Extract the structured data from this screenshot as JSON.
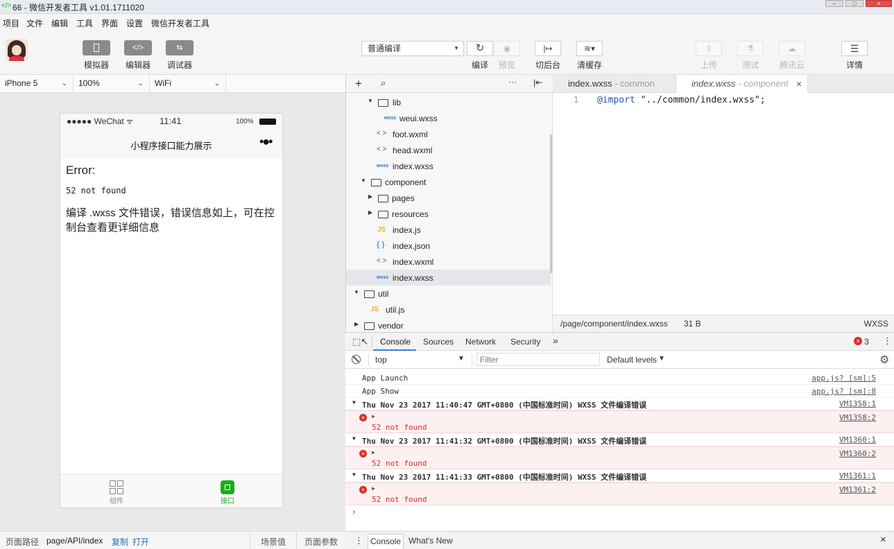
{
  "window": {
    "title": "66 - 微信开发者工具 v1.01.1711020"
  },
  "menu": [
    "项目",
    "文件",
    "编辑",
    "工具",
    "界面",
    "设置",
    "微信开发者工具"
  ],
  "toolbar": {
    "simulator": "模拟器",
    "editor": "编辑器",
    "debugger": "调试器",
    "compile_mode": "普通编译",
    "compile": "编译",
    "preview": "预览",
    "background": "切后台",
    "clear_cache": "清缓存",
    "upload": "上传",
    "test": "测试",
    "tencent_cloud": "腾讯云",
    "details": "详情"
  },
  "device": {
    "model": "iPhone 5",
    "zoom": "100%",
    "network": "WiFi"
  },
  "phone": {
    "carrier": "●●●●● WeChat",
    "time": "11:41",
    "battery": "100%",
    "nav_title": "小程序接口能力展示",
    "error_title": "Error:",
    "error_code": "52 not found",
    "error_msg": "编译 .wxss 文件错误，错误信息如上，可在控制台查看更详细信息",
    "tab_component": "组件",
    "tab_api": "接口"
  },
  "left_status": {
    "path_label": "页面路径",
    "path": "page/API/index",
    "copy": "复制",
    "open": "打开",
    "scene": "场景值",
    "params": "页面参数"
  },
  "tree": [
    {
      "name": "lib",
      "type": "folder",
      "open": true
    },
    {
      "name": "weui.wxss",
      "type": "wxss"
    },
    {
      "name": "foot.wxml",
      "type": "wxml"
    },
    {
      "name": "head.wxml",
      "type": "wxml"
    },
    {
      "name": "index.wxss",
      "type": "wxss"
    },
    {
      "name": "component",
      "type": "folder",
      "open": true
    },
    {
      "name": "pages",
      "type": "folder",
      "open": false
    },
    {
      "name": "resources",
      "type": "folder",
      "open": false
    },
    {
      "name": "index.js",
      "type": "js"
    },
    {
      "name": "index.json",
      "type": "json"
    },
    {
      "name": "index.wxml",
      "type": "wxml"
    },
    {
      "name": "index.wxss",
      "type": "wxss",
      "selected": true
    },
    {
      "name": "util",
      "type": "folder",
      "open": true
    },
    {
      "name": "util.js",
      "type": "js"
    },
    {
      "name": "vendor",
      "type": "folder",
      "open": false
    }
  ],
  "icons": {
    "js": "JS",
    "wxml": "< >",
    "json": "{ }",
    "wxss": "wxss"
  },
  "editor": {
    "tab1_name": "index.wxss",
    "tab1_dir": " - common",
    "tab2_name": "index.wxss",
    "tab2_dir": " - component",
    "line_no": "1",
    "code_kw": "@import",
    "code_str": " \"../common/index.wxss\";",
    "file_path": "/page/component/index.wxss",
    "file_size": "31 B",
    "lang": "WXSS"
  },
  "devtools": {
    "tabs": [
      "Console",
      "Sources",
      "Network",
      "Security"
    ],
    "more": "»",
    "error_count": "3",
    "context": "top",
    "filter_placeholder": "Filter",
    "levels": "Default levels",
    "logs": [
      {
        "kind": "info",
        "text": "App Launch",
        "src": "app.js? [sm]:5"
      },
      {
        "kind": "info",
        "text": "App Show",
        "src": "app.js? [sm]:8"
      },
      {
        "kind": "group",
        "text": "Thu Nov 23 2017 11:40:47 GMT+0800 (中国标准时间)  WXSS 文件编译错误",
        "src": "VM1358:1"
      },
      {
        "kind": "error",
        "text": "52 not found",
        "src": "VM1358:2"
      },
      {
        "kind": "group",
        "text": "Thu Nov 23 2017 11:41:32 GMT+0800 (中国标准时间)  WXSS 文件编译错误",
        "src": "VM1360:1"
      },
      {
        "kind": "error",
        "text": "52 not found",
        "src": "VM1360:2"
      },
      {
        "kind": "group",
        "text": "Thu Nov 23 2017 11:41:33 GMT+0800 (中国标准时间)  WXSS 文件编译错误",
        "src": "VM1361:1"
      },
      {
        "kind": "error",
        "text": "52 not found",
        "src": "VM1361:2"
      }
    ],
    "prompt": "›",
    "drawer_console": "Console",
    "drawer_whatsnew": "What's New"
  },
  "colors": {
    "accent": "#1aad19",
    "error": "#d93026",
    "error_bg": "#fdf0f0",
    "link": "#2d6fb7"
  }
}
